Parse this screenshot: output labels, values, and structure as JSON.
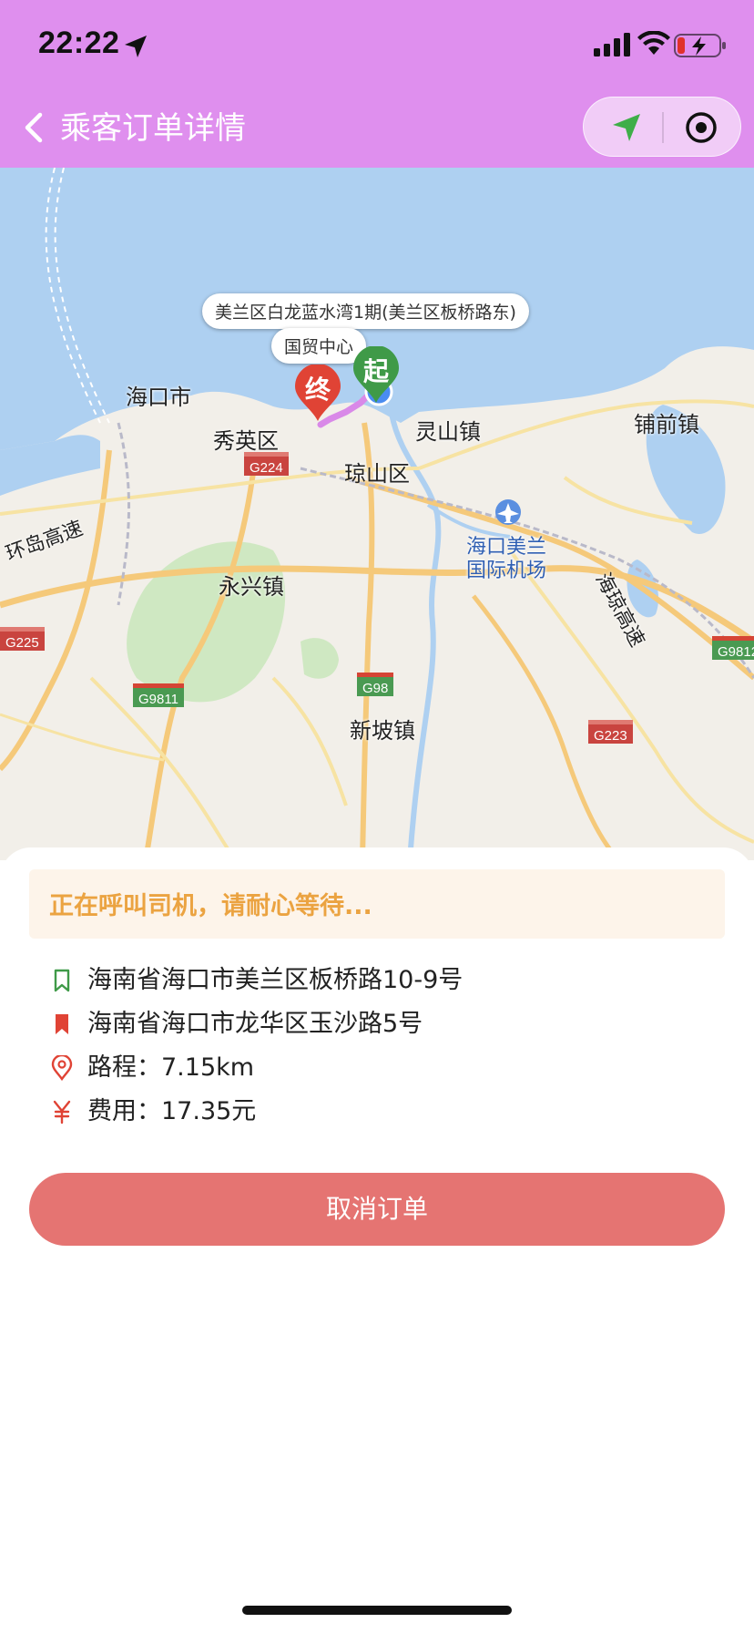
{
  "status_bar": {
    "time": "22:22"
  },
  "nav": {
    "title": "乘客订单详情"
  },
  "map": {
    "labels": {
      "haikou": "海口市",
      "xiuying": "秀英区",
      "qiongshan": "琼山区",
      "lingshan": "灵山镇",
      "puqian": "铺前镇",
      "yongxing": "永兴镇",
      "xinpo": "新坡镇",
      "airport_l1": "海口美兰",
      "airport_l2": "国际机场",
      "ring_expressway": "环岛高速",
      "haiqiong_expressway": "海琼高速"
    },
    "shields": {
      "g224": "G224",
      "g225": "G225",
      "g9811": "G9811",
      "g98": "G98",
      "g223": "G223",
      "g9812": "G9812"
    },
    "bubbles": {
      "start": "美兰区白龙蓝水湾1期(美兰区板桥路东)",
      "end": "国贸中心"
    },
    "pins": {
      "start": "起",
      "end": "终"
    }
  },
  "order": {
    "status": "正在呼叫司机，请耐心等待...",
    "start_address": "海南省海口市美兰区板桥路10-9号",
    "end_address": "海南省海口市龙华区玉沙路5号",
    "distance": "路程：7.15km",
    "fee": "费用：17.35元",
    "cancel_label": "取消订单"
  },
  "colors": {
    "header_bg": "#df8fee",
    "notice_text": "#eba341",
    "cancel_bg": "#e57472",
    "start_green": "#3f9a48",
    "end_red": "#e04335"
  }
}
